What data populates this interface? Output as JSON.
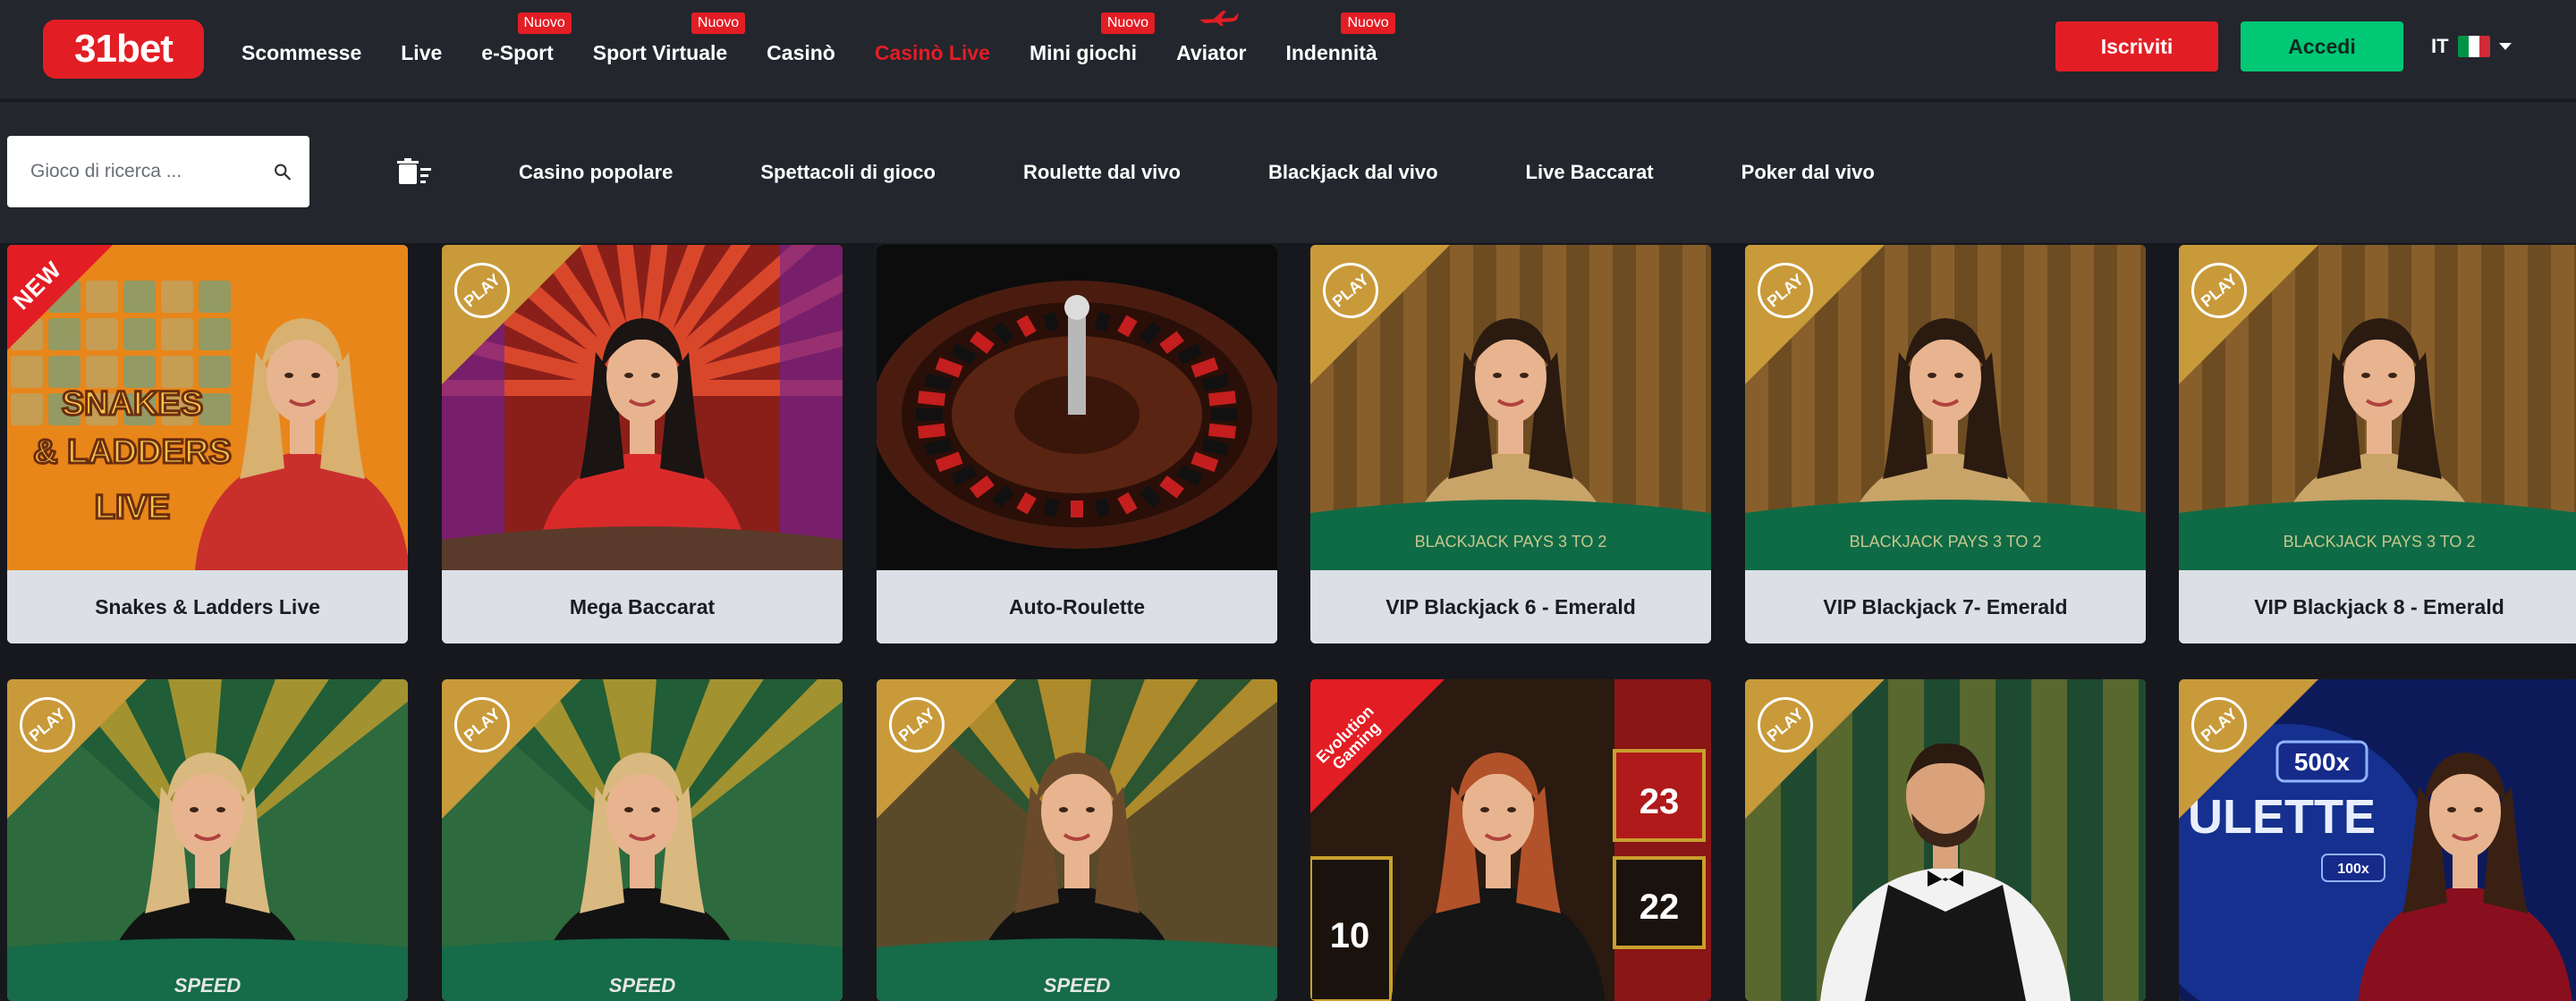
{
  "brand": {
    "logo_text": "31bet",
    "accent": "#e31d24",
    "green": "#00c875"
  },
  "nav": {
    "items": [
      {
        "label": "Scommesse"
      },
      {
        "label": "Live"
      },
      {
        "label": "e-Sport",
        "badge": "Nuovo"
      },
      {
        "label": "Sport Virtuale",
        "badge": "Nuovo"
      },
      {
        "label": "Casinò"
      },
      {
        "label": "Casinò Live",
        "active": true
      },
      {
        "label": "Mini giochi",
        "badge": "Nuovo"
      },
      {
        "label": "Aviator",
        "icon": "airplane-icon"
      },
      {
        "label": "Indennità",
        "badge": "Nuovo"
      }
    ],
    "signup_label": "Iscriviti",
    "login_label": "Accedi",
    "language": "IT"
  },
  "subnav": {
    "search_placeholder": "Gioco di ricerca ...",
    "categories": [
      "Casino popolare",
      "Spettacoli di gioco",
      "Roulette dal vivo",
      "Blackjack dal vivo",
      "Live Baccarat",
      "Poker dal vivo"
    ]
  },
  "games": [
    {
      "title": "Snakes & Ladders Live",
      "tag": "NEW",
      "scene": "snakes"
    },
    {
      "title": "Mega Baccarat",
      "tag": "PLAY",
      "scene": "baccarat"
    },
    {
      "title": "Auto-Roulette",
      "tag": "",
      "scene": "roulette"
    },
    {
      "title": "VIP Blackjack 6 - Emerald",
      "tag": "PLAY",
      "scene": "blackjack"
    },
    {
      "title": "VIP Blackjack 7- Emerald",
      "tag": "PLAY",
      "scene": "blackjack"
    },
    {
      "title": "VIP Blackjack 8 - Emerald",
      "tag": "PLAY",
      "scene": "blackjack"
    },
    {
      "title": "",
      "tag": "PLAY",
      "scene": "speed"
    },
    {
      "title": "",
      "tag": "PLAY",
      "scene": "speed"
    },
    {
      "title": "",
      "tag": "PLAY",
      "scene": "speed2"
    },
    {
      "title": "",
      "tag": "Evolution Gaming",
      "scene": "evo"
    },
    {
      "title": "",
      "tag": "PLAY",
      "scene": "dealer"
    },
    {
      "title": "",
      "tag": "PLAY",
      "scene": "roulette500"
    }
  ],
  "thumb_text": {
    "snakes_logo_1": "SNAKES",
    "snakes_logo_2": "& LADDERS",
    "snakes_logo_3": "LIVE",
    "blackjack_table": "BLACKJACK PAYS 3 TO 2",
    "speed_table": "SPEED",
    "evo_numbers": [
      "23",
      "10",
      "22"
    ],
    "roulette_multiplier": "500x",
    "roulette_multiplier_2": "100x",
    "roulette_word": "ULETTE"
  }
}
